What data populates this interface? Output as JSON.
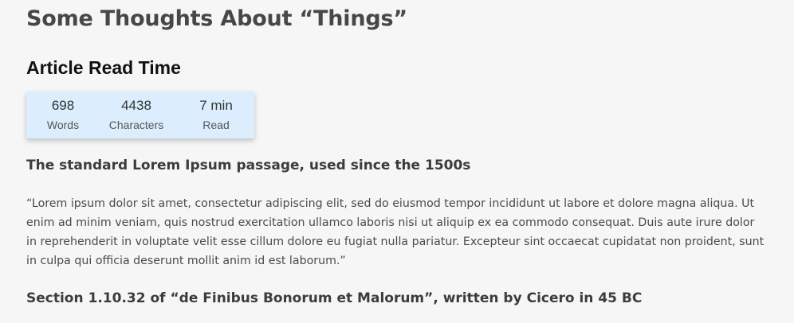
{
  "page": {
    "title": "Some Thoughts About “Things”"
  },
  "read_time": {
    "title": "Article Read Time",
    "stats": {
      "words": {
        "value": "698",
        "label": "Words"
      },
      "characters": {
        "value": "4438",
        "label": "Characters"
      },
      "read": {
        "value": "7 min",
        "label": "Read"
      }
    }
  },
  "article": {
    "section1": {
      "heading": "The standard Lorem Ipsum passage, used since the 1500s",
      "body": "“Lorem ipsum dolor sit amet, consectetur adipiscing elit, sed do eiusmod tempor incididunt ut labore et dolore magna aliqua. Ut enim ad minim veniam, quis nostrud exercitation ullamco laboris nisi ut aliquip ex ea commodo consequat. Duis aute irure dolor in reprehenderit in voluptate velit esse cillum dolore eu fugiat nulla pariatur. Excepteur sint occaecat cupidatat non proident, sunt in culpa qui officia deserunt mollit anim id est laborum.”"
    },
    "section2": {
      "heading": "Section 1.10.32 of “de Finibus Bonorum et Malorum”, written by Cicero in 45 BC"
    }
  },
  "colors": {
    "background": "#f6f6f6",
    "card_background": "#dceefd",
    "title_text": "#474747",
    "widget_title_text": "#111111",
    "body_text": "#4a4a4a"
  }
}
